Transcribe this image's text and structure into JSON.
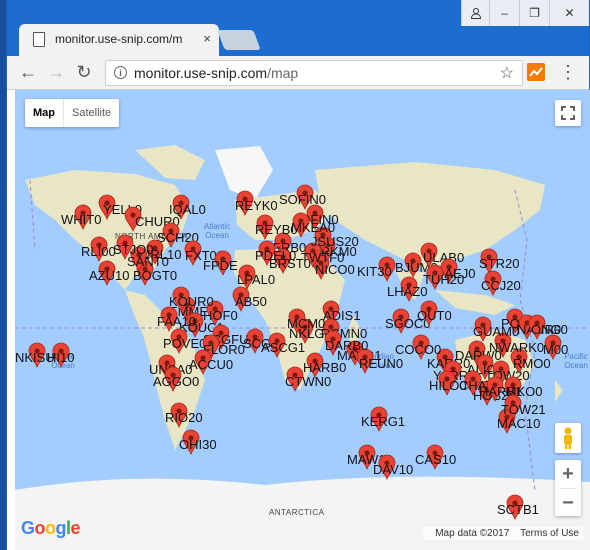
{
  "browser": {
    "tab_title": "monitor.use-snip.com/m",
    "tab_close": "×",
    "url_host": "monitor.use-snip.com",
    "url_path": "/map",
    "back_icon": "←",
    "forward_icon": "→",
    "reload_icon": "↻",
    "star_icon": "☆",
    "menu_icon": "⋮",
    "window_min": "–",
    "window_max": "❐",
    "window_close": "✕"
  },
  "map": {
    "type_map_label": "Map",
    "type_satellite_label": "Satellite",
    "zoom_in": "+",
    "zoom_out": "−",
    "credits_data": "Map data ©2017",
    "credits_terms": "Terms of Use",
    "logo_letters": [
      "G",
      "o",
      "o",
      "g",
      "l",
      "e"
    ],
    "logo_colors": [
      "#4285f4",
      "#ea4335",
      "#fbbc05",
      "#4285f4",
      "#34a853",
      "#ea4335"
    ],
    "place_labels": [
      "NORTH AMERICA",
      "ANTARCTICA"
    ],
    "ocean_labels": [
      "Pacific Ocean",
      "Pacific Ocean",
      "Indian Ocean",
      "Atlantic Ocean"
    ],
    "marker_color": "#ea4335",
    "station_labels": [
      "WHIT0",
      "YELL0",
      "CHUR0",
      "IQAL0",
      "REYK0",
      "SCH20",
      "RLI00",
      "NRL10",
      "AZU10",
      "FXT00",
      "FPDE",
      "LPAL0",
      "EMMEO",
      "KOUC1",
      "POVE0",
      "SCGFU0",
      "UNSA0",
      "AGGO0",
      "RIO20",
      "OHI30",
      "FLOR0",
      "ACCU0",
      "AB50",
      "SOFIN0",
      "DFIN0",
      "FRB0",
      "REYB0",
      "NICO0",
      "ADIS1",
      "NKLG0",
      "RCMN0",
      "MAYG1",
      "REUN0",
      "CTWN0",
      "HARB0",
      "SGOC0",
      "LHAZ0",
      "KIT30",
      "BJUM0",
      "ULAB0",
      "DAEJ0",
      "STR20",
      "CCJ20",
      "TUH20",
      "POHN0",
      "NAUR0",
      "ONG0",
      "M00",
      "KARR0",
      "DARW0",
      "COCO0",
      "ALIC0",
      "YARR",
      "TOW20",
      "HOB20",
      "MAC10",
      "CAS10",
      "MAW10",
      "DAV10",
      "KERG1",
      "SCTB1",
      "NKISU",
      "HI10",
      "SCG1",
      "MCM0",
      "OUT0",
      "DARB0",
      "HILO0",
      "CHAT0",
      "ASCG1",
      "RMO0",
      "PMKO0",
      "HARB1",
      "NWARK0",
      "IRKM0",
      "BRST0",
      "TWTF0",
      "JSUS20",
      "MKEA0",
      "FAA10",
      "HOF0",
      "PDEL0",
      "KOUR0",
      "BOGT0",
      "SANT0",
      "STJO0",
      "GUAM0",
      "TOW21"
    ]
  }
}
